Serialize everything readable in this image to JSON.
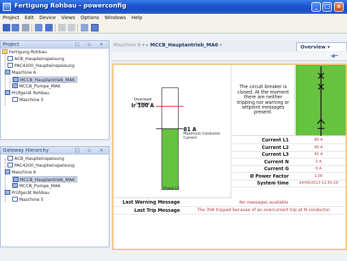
{
  "window": {
    "title": "Fertigung Rohbau - powerconfig",
    "colors": {
      "accent": "#f3c576",
      "ok_green": "#66c23f",
      "alert_red": "#cc2222",
      "value_red": "#b0303a"
    }
  },
  "menu": [
    "Project",
    "Edit",
    "Device",
    "Views",
    "Options",
    "Windows",
    "Help"
  ],
  "project_panel": {
    "title": "Project",
    "tree": [
      {
        "label": "Fertigung Rohbau",
        "icon": "folder-icon"
      },
      {
        "label": "ACB_Haupteinspeisung",
        "icon": "device-icon"
      },
      {
        "label": "PAC4200_Haupteinspeisung",
        "icon": "meter-icon"
      },
      {
        "label": "Maschine 6",
        "icon": "group-icon"
      },
      {
        "label": "MCCB_Hauptantrieb_MA6",
        "icon": "breaker-icon",
        "selected": true
      },
      {
        "label": "MCCB_Pumpe_MA6",
        "icon": "breaker-icon"
      },
      {
        "label": "Prüfgerät Rohbau",
        "icon": "group-icon"
      },
      {
        "label": "Maschine 5",
        "icon": "device-icon"
      }
    ]
  },
  "gateway_panel": {
    "title": "Gateway Hierarchy",
    "tree": [
      {
        "label": "ACB_Haupteinspeisung",
        "icon": "device-icon"
      },
      {
        "label": "PAC4200_Haupteinspeisung",
        "icon": "meter-icon"
      },
      {
        "label": "Maschine 6",
        "icon": "group-icon"
      },
      {
        "label": "MCCB_Hauptantrieb_MA6",
        "icon": "breaker-icon",
        "selected": true
      },
      {
        "label": "MCCB_Pumpe_MA6",
        "icon": "breaker-icon"
      },
      {
        "label": "Prüfgerät Rohbau",
        "icon": "group-icon"
      },
      {
        "label": "Maschine 5",
        "icon": "device-icon"
      }
    ]
  },
  "breadcrumb": {
    "parent": "Maschine 6",
    "current": "MCCB_Hauptantrieb_MA6"
  },
  "tab": {
    "label": "Overview"
  },
  "gauge": {
    "overload_label": "Overload release",
    "overload_value": "Ir 100 A",
    "current_value": "81 A",
    "current_label": "Maximum Conductor Current",
    "phase_label": "Phase L3",
    "fill_fraction": 0.6,
    "overload_fraction": 0.82
  },
  "status_message": "The circuit breaker is closed. At the moment there are neither tripping nor warning or setpoint messages present.",
  "measurements": [
    {
      "label": "Current L1",
      "value": "80 A"
    },
    {
      "label": "Current L2",
      "value": "80 A"
    },
    {
      "label": "Current L3",
      "value": "81 A"
    },
    {
      "label": "Current N",
      "value": "1 A"
    },
    {
      "label": "Current G",
      "value": "0 A"
    },
    {
      "label": "Ø Power Factor",
      "value": "1.00"
    },
    {
      "label": "System time",
      "value": "24/09/2013 12:55:29"
    }
  ],
  "messages": [
    {
      "label": "Last Warning Message",
      "value": "No messages available"
    },
    {
      "label": "Last Trip Message",
      "value": "The 3VA tripped because of an overcurrent trip at N conductor."
    }
  ]
}
